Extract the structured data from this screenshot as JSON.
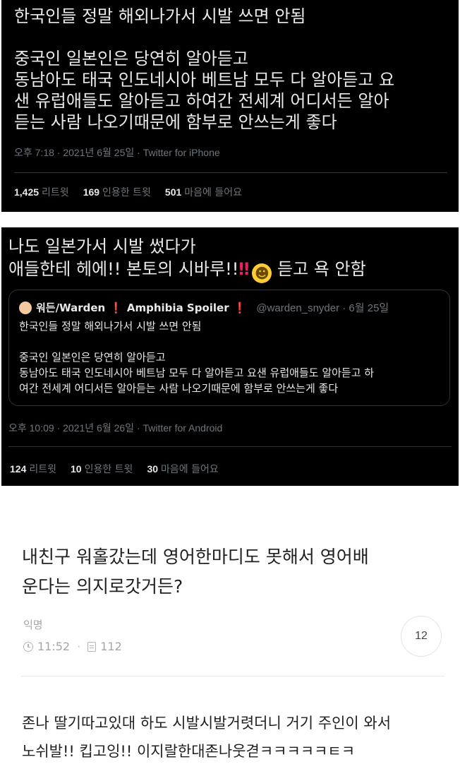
{
  "tweet1": {
    "lines": [
      "한국인들 정말 해외나가서 시발 쓰면 안됨",
      "",
      "중국인 일본인은 당연히 알아듣고",
      "동남아도 태국 인도네시아 베트남 모두 다 알아듣고 요",
      "샌 유럽애들도 알아듣고 하여간 전세계 어디서든 알아",
      "듣는 사람 나오기때문에 함부로 안쓰는게 좋다"
    ],
    "meta": "오후 7:18 · 2021년 6월 25일 · Twitter for iPhone",
    "retweets": {
      "count": "1,425",
      "label": "리트윗"
    },
    "quotes": {
      "count": "169",
      "label": "인용한 트윗"
    },
    "likes": {
      "count": "501",
      "label": "마음에 들어요"
    }
  },
  "tweet2": {
    "line1": "나도 일본가서 시발 썼다가",
    "line2_text": "애들한테 헤에!! 본토의 시바루!!",
    "line2_bangs": "‼",
    "line2_emoji": "☻",
    "line2_tail": " 듣고 욕 안함",
    "quote": {
      "name": "워든/Warden",
      "mark1": "❗",
      "spoiler": "Amphibia Spoiler",
      "mark2": "❗",
      "handle": "@warden_snyder · 6월 25일",
      "lines": [
        "한국인들 정말 해외나가서 시발 쓰면 안됨",
        "",
        "중국인 일본인은 당연히 알아듣고",
        "동남아도 태국 인도네시아 베트남 모두 다 알아듣고 요샌 유럽애들도 알아듣고 하",
        "여간 전세계 어디서든 알아듣는 사람 나오기때문에 함부로 안쓰는게 좋다"
      ]
    },
    "meta": "오후 10:09 · 2021년 6월 26일 · Twitter for Android",
    "retweets": {
      "count": "124",
      "label": "리트윗"
    },
    "quotes": {
      "count": "10",
      "label": "인용한 트윗"
    },
    "likes": {
      "count": "30",
      "label": "마음에 들어요"
    }
  },
  "post": {
    "title_lines": [
      "내친구 워홀갔는데 영어한마디도 못해서 영어배",
      "운다는 의지로갓거든?"
    ],
    "author": "익명",
    "time": "11:52",
    "views": "112",
    "comment_count": "12",
    "body_lines": [
      "존나 딸기따고있대 하도 시발시발거렷더니 거기 주인이 와서",
      "노쉬발!! 킵고잉!! 이지랄한대존나웃겯ㅋㅋㅋㅋㅋㅌㅋ"
    ]
  },
  "icons": {
    "clock": "clock-icon",
    "views": "document-icon",
    "avatar": "avatar"
  },
  "colors": {
    "tweet_bg": "#000000",
    "tweet_text": "#e7e9ea",
    "tweet_meta": "#6e767d",
    "alert_red": "#e0245e",
    "post_text": "#1f1f1f",
    "post_meta": "#a5a5a5"
  }
}
